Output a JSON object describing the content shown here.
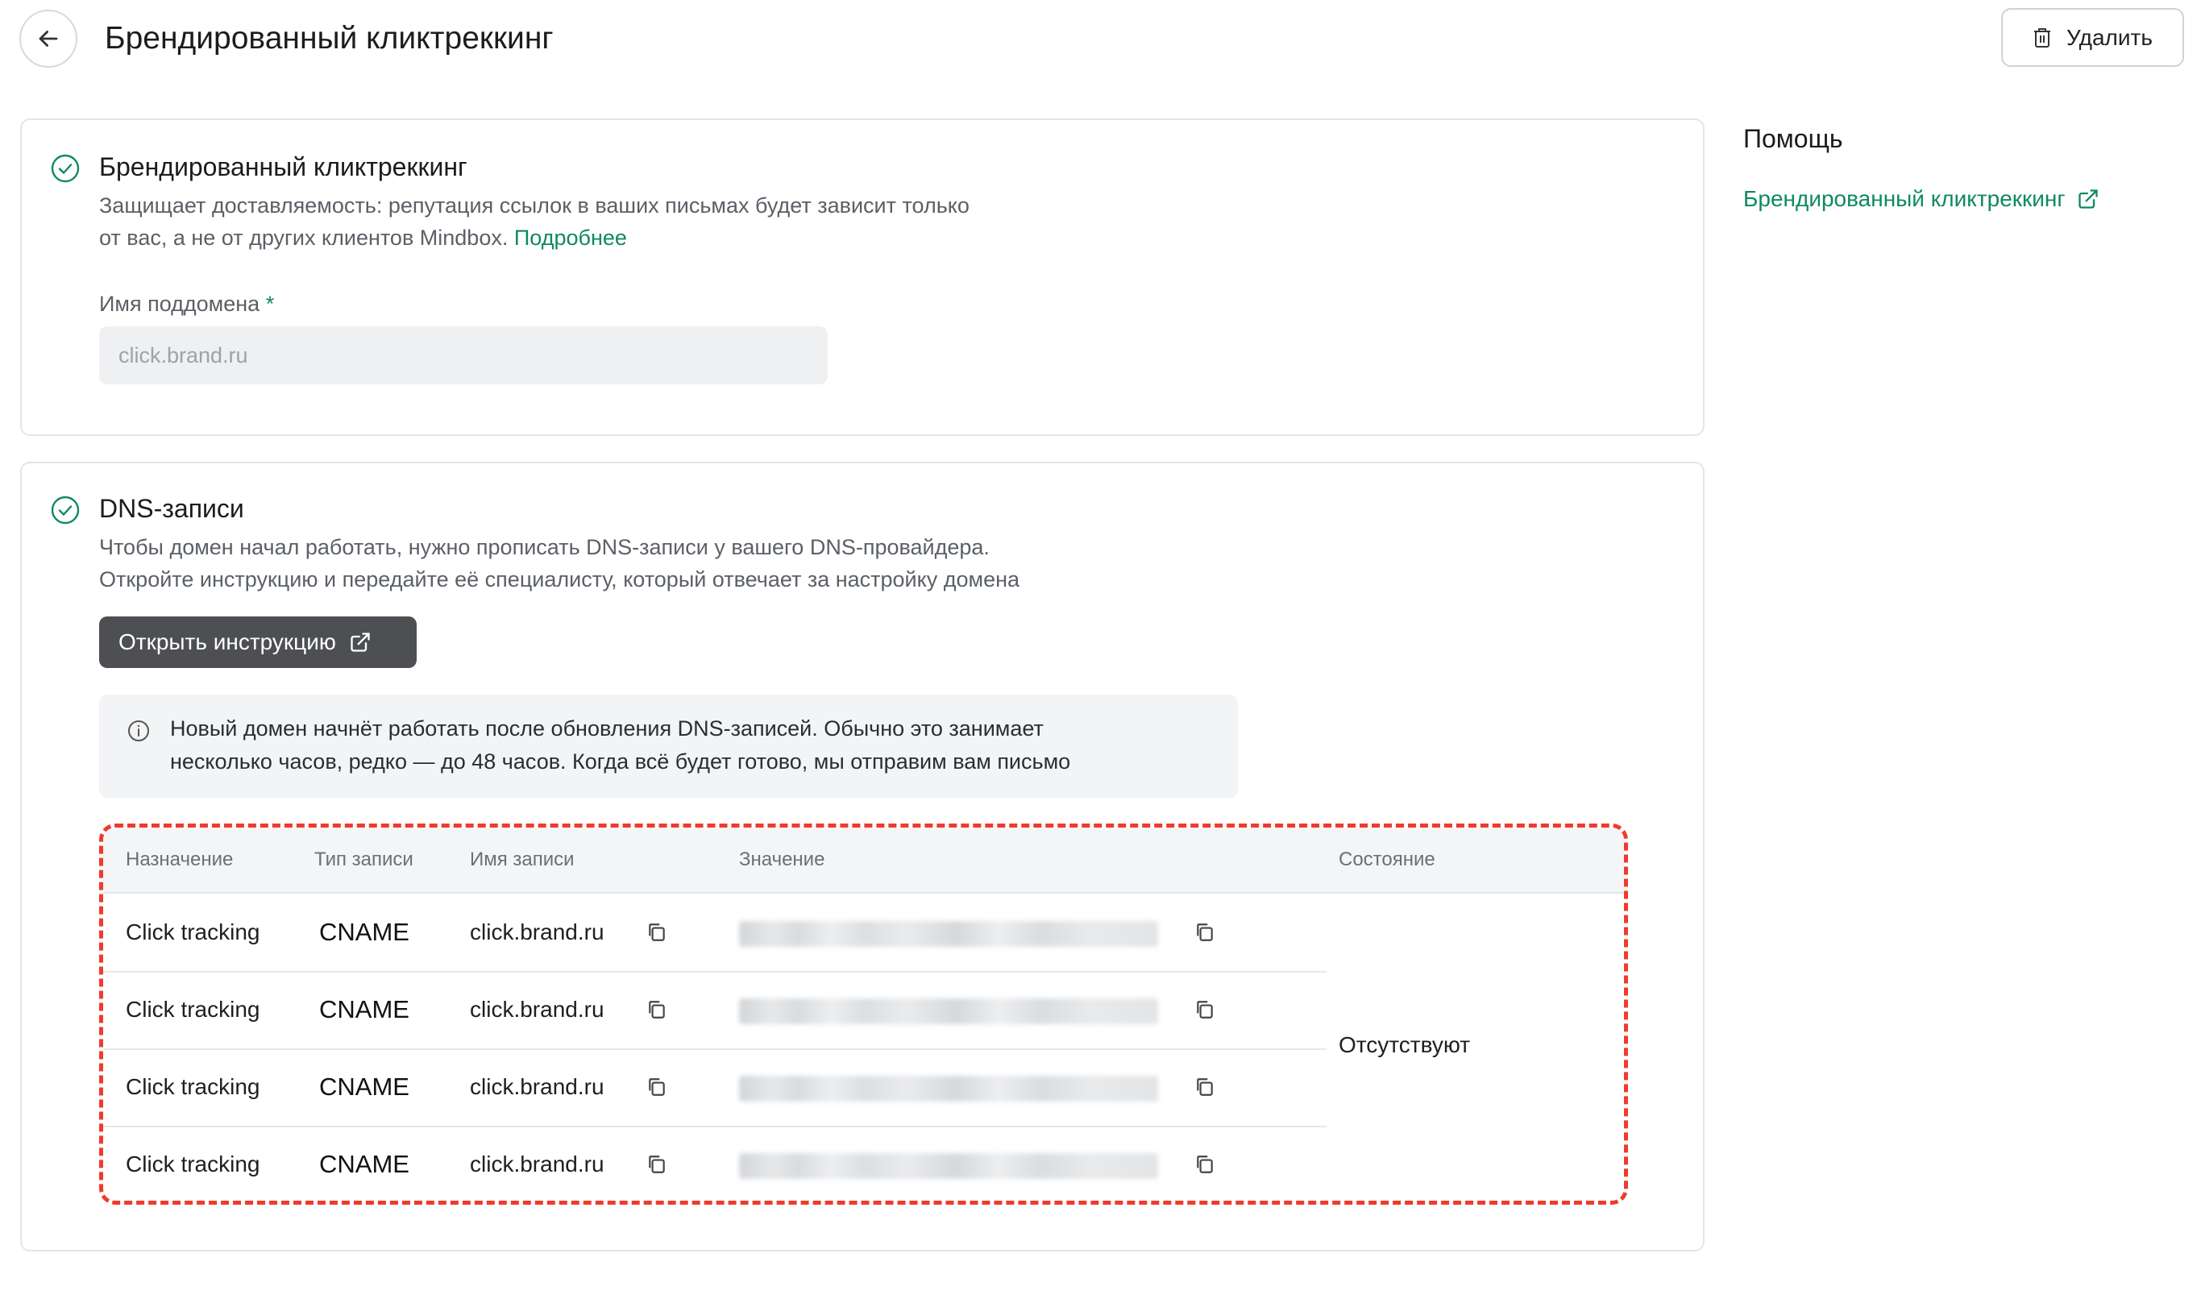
{
  "header": {
    "title": "Брендированный кликтреккинг",
    "delete_label": "Удалить"
  },
  "subdomain_card": {
    "title": "Брендированный кликтреккинг",
    "desc_line1": "Защищает доставляемость: репутация ссылок в ваших письмах будет зависит только",
    "desc_line2": "от вас, а не от других клиентов Mindbox.",
    "more_link": "Подробнее",
    "field_label": "Имя поддомена",
    "required_mark": "*",
    "field_placeholder": "click.brand.ru"
  },
  "dns_card": {
    "title": "DNS-записи",
    "desc_line1": "Чтобы домен начал работать, нужно прописать DNS-записи у вашего DNS-провайдера.",
    "desc_line2": "Откройте  инструкцию и передайте её специалисту, который отвечает за настройку домена",
    "instruction_button": "Открыть инструкцию",
    "info_line1": "Новый домен начнёт работать после обновления DNS-записей. Обычно это занимает",
    "info_line2": "несколько часов, редко — до 48 часов. Когда всё будет готово, мы отправим вам письмо"
  },
  "table": {
    "headers": [
      "Назначение",
      "Тип записи",
      "Имя записи",
      "Значение",
      "Состояние"
    ],
    "rows": [
      {
        "purpose": "Click tracking",
        "type": "CNAME",
        "name": "click.brand.ru"
      },
      {
        "purpose": "Click tracking",
        "type": "CNAME",
        "name": "click.brand.ru"
      },
      {
        "purpose": "Click tracking",
        "type": "CNAME",
        "name": "click.brand.ru"
      },
      {
        "purpose": "Click tracking",
        "type": "CNAME",
        "name": "click.brand.ru"
      }
    ],
    "status": "Отсутствуют"
  },
  "help": {
    "title": "Помощь",
    "link": "Брендированный кликтреккинг"
  },
  "colors": {
    "accent": "#0f8a5f",
    "dark_button": "#4d4f52",
    "highlight_dash": "#ef3b2d"
  },
  "icons": [
    "back-arrow-icon",
    "trash-icon",
    "check-circle-icon",
    "external-link-icon",
    "info-icon",
    "copy-icon"
  ]
}
